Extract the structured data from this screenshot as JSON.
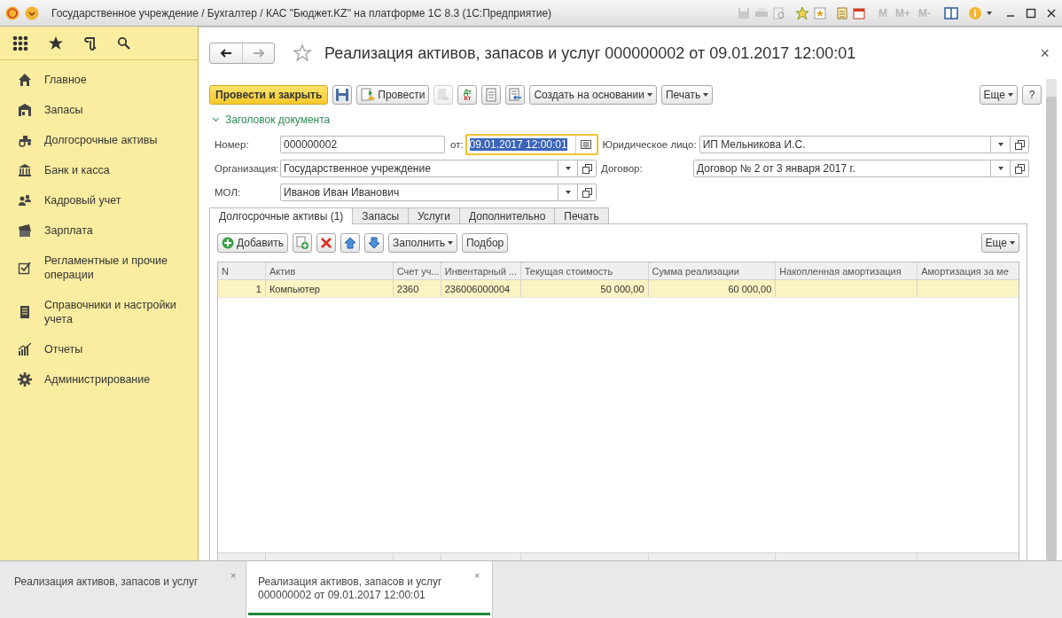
{
  "window": {
    "title": "Государственное учреждение / Бухгалтер / КАС \"Бюджет.KZ\" на платформе 1С 8.3  (1С:Предприятие)",
    "memory_buttons": [
      {
        "label": "M",
        "disabled": true
      },
      {
        "label": "M+",
        "disabled": true
      },
      {
        "label": "M-",
        "disabled": true
      }
    ]
  },
  "sidebar": {
    "items": [
      {
        "label": "Главное"
      },
      {
        "label": "Запасы"
      },
      {
        "label": "Долгосрочные активы"
      },
      {
        "label": "Банк и касса"
      },
      {
        "label": "Кадровый учет"
      },
      {
        "label": "Зарплата"
      },
      {
        "label": "Регламентные и прочие операции"
      },
      {
        "label": "Справочники и настройки учета"
      },
      {
        "label": "Отчеты"
      },
      {
        "label": "Администрирование"
      }
    ]
  },
  "document": {
    "title": "Реализация активов, запасов и услуг 000000002 от 09.01.2017 12:00:01",
    "close": "×",
    "toolbar": [
      {
        "kind": "primary",
        "label": "Провести и закрыть"
      },
      {
        "kind": "icon",
        "disabled": false
      },
      {
        "kind": "icon_text",
        "label": "Провести"
      },
      {
        "kind": "icon",
        "disabled": true
      },
      {
        "kind": "dtkt",
        "top": "Дт",
        "bottom": "Кт"
      },
      {
        "kind": "icon",
        "disabled": false
      },
      {
        "kind": "icon",
        "disabled": false
      },
      {
        "kind": "menu",
        "label": "Создать на основании"
      },
      {
        "kind": "menu",
        "label": "Печать"
      }
    ],
    "more": "Еще",
    "help": "?",
    "group": {
      "label": "Заголовок документа",
      "expanded": true
    },
    "field_rows": [
      [
        {
          "kind": "text",
          "label": "Номер:",
          "value": "000000002"
        },
        {
          "kind": "date",
          "label": "от:",
          "value": "09.01.2017 12:00:01",
          "focused": true
        },
        {
          "kind": "select",
          "label": "Юридическое лицо:",
          "value": "ИП Мельникова И.С."
        }
      ],
      [
        {
          "kind": "select",
          "label": "Организация:",
          "value": "Государственное учреждение"
        },
        {
          "kind": "select",
          "label": "Договор:",
          "value": "Договор № 2 от 3 января 2017 г."
        }
      ],
      [
        {
          "kind": "select",
          "label": "МОЛ:",
          "value": "Иванов Иван Иванович"
        }
      ]
    ],
    "tabs": [
      {
        "label": "Долгосрочные активы (1)",
        "selected": true
      },
      {
        "label": "Запасы",
        "selected": false
      },
      {
        "label": "Услуги",
        "selected": false
      },
      {
        "label": "Дополнительно",
        "selected": false
      },
      {
        "label": "Печать",
        "selected": false
      }
    ],
    "table_toolbar": [
      {
        "kind": "icon_text",
        "label": "Добавить"
      },
      {
        "kind": "icon"
      },
      {
        "kind": "icon"
      },
      {
        "kind": "icon"
      },
      {
        "kind": "icon"
      },
      {
        "kind": "menu",
        "label": "Заполнить"
      },
      {
        "kind": "text",
        "label": "Подбор"
      }
    ],
    "table_more": "Еще",
    "table": {
      "columns": [
        "N",
        "Актив",
        "Счет уч...",
        "Инвентарный ...",
        "Текущая стоимость",
        "Сумма реализации",
        "Накопленная амортизация",
        "Амортизация за ме"
      ],
      "rows": [
        {
          "selected": true,
          "cells": [
            "1",
            "Компьютер",
            "2360",
            "236006000004",
            "50 000,00",
            "60 000,00",
            "",
            ""
          ]
        }
      ]
    }
  },
  "open_windows": [
    {
      "title": "Реализация активов, запасов и услуг",
      "close": "×",
      "selected": false
    },
    {
      "title": "Реализация активов, запасов и услуг 000000002 от 09.01.2017 12:00:01",
      "close": "×",
      "selected": true
    }
  ]
}
